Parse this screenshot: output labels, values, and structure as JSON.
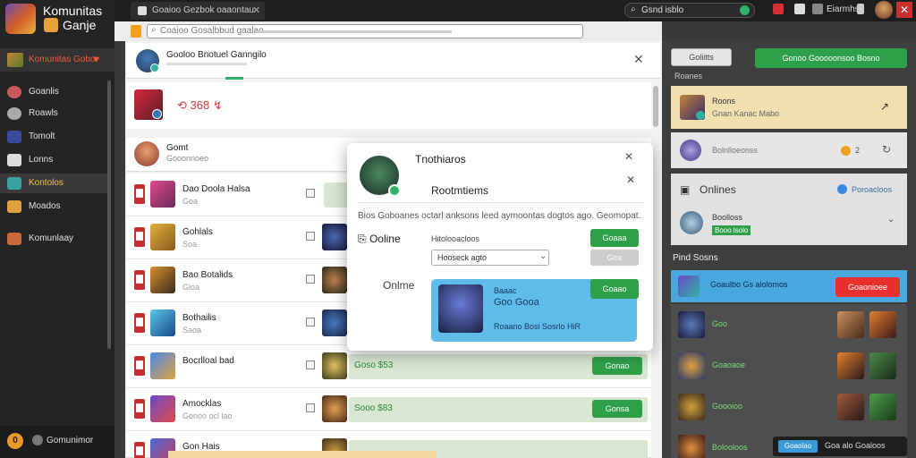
{
  "app": {
    "brand_line1": "Komunitas",
    "brand_line2": "Ganje"
  },
  "browser": {
    "tab_title": "Goaioo Gezbok oaaontau",
    "search_text": "Gsnd isblo",
    "top_name": "Eiarmhs",
    "address_text": "Coaioo Gosalbbud gaalao"
  },
  "sidebar": {
    "featured": "Komunitas Gobo",
    "items": [
      {
        "label": "Goanlis",
        "icon": "community-icon"
      },
      {
        "label": "Roawls",
        "icon": "forums-icon"
      },
      {
        "label": "Tomolt",
        "icon": "news-icon"
      },
      {
        "label": "Lonns",
        "icon": "store-icon"
      },
      {
        "label": "Kontolos",
        "icon": "games-icon"
      },
      {
        "label": "Moados",
        "icon": "mods-icon"
      },
      {
        "label": "Komunlaay",
        "icon": "komunitas-icon"
      }
    ],
    "active_index": 4,
    "bottom_coin": "0",
    "bottom_label": "Gomunimor"
  },
  "main": {
    "header_title": "Gooloo Bnotuel Ganngilo",
    "stat_value": "368",
    "list_title": "Gomt",
    "list_subtitle": "Gooonnoeo",
    "rows": [
      {
        "name": "Dao Doola Halsa",
        "sub": "Goa",
        "price": "",
        "btn": ""
      },
      {
        "name": "Gohlals",
        "sub": "Soa",
        "price": "",
        "btn": ""
      },
      {
        "name": "Bao Botalids",
        "sub": "Gioa",
        "price": "",
        "btn": ""
      },
      {
        "name": "Bothailis",
        "sub": "Saoa",
        "price": "",
        "btn": ""
      },
      {
        "name": "Bocrlloal bad",
        "sub": "",
        "price": "Goso $53",
        "btn": "Gonao"
      },
      {
        "name": "Amocklas",
        "sub": "Gonoo ocl lao",
        "price": "Sooo $83",
        "btn": "Gonsa"
      },
      {
        "name": "Gon Hais",
        "sub": "",
        "price": "",
        "btn": ""
      }
    ]
  },
  "modal": {
    "title": "Tnothiaros",
    "subtitle": "Rootmtiems",
    "description": "Bios Goboanes octarl anksons leed aymoontas dogtos ago. Geomopat.",
    "online_label_1": "Ooline",
    "field_label": "Hitolooacloos",
    "btn_primary": "Goaaa",
    "select_value": "Hooseck agto",
    "btn_secondary": "Gox",
    "online_label_2": "Onlme",
    "card_line1": "Baaac",
    "card_line2": "Goo Gooa",
    "card_line3": "Roaano Bosi Sosrlo HiR",
    "card_btn": "Goaao"
  },
  "right": {
    "btn_outline": "Goliitts",
    "btn_green": "Gonoo Gooooonsoo Bosno",
    "section_label": "Roanes",
    "game_title": "Roons",
    "game_sub": "Gnan Kanac Mabo",
    "stat_text": "Bolnlloeonss",
    "stat_count": "2",
    "online_title": "Onlines",
    "online_link": "Poroacloos",
    "online_name": "Boolloss",
    "online_tag": "Booo lsolo",
    "friends_title": "Pind Sosns",
    "highlight_text": "Goaulbo Gs alolomos",
    "highlight_btn": "Goaonioee",
    "friend_rows": [
      {
        "text": "Goo"
      },
      {
        "text": "Goaoaoe"
      },
      {
        "text": "Goooioo"
      },
      {
        "text": "Bolooloos"
      }
    ],
    "toast_btn": "Goaolao",
    "toast_text": "Goa alo Goaloos"
  }
}
